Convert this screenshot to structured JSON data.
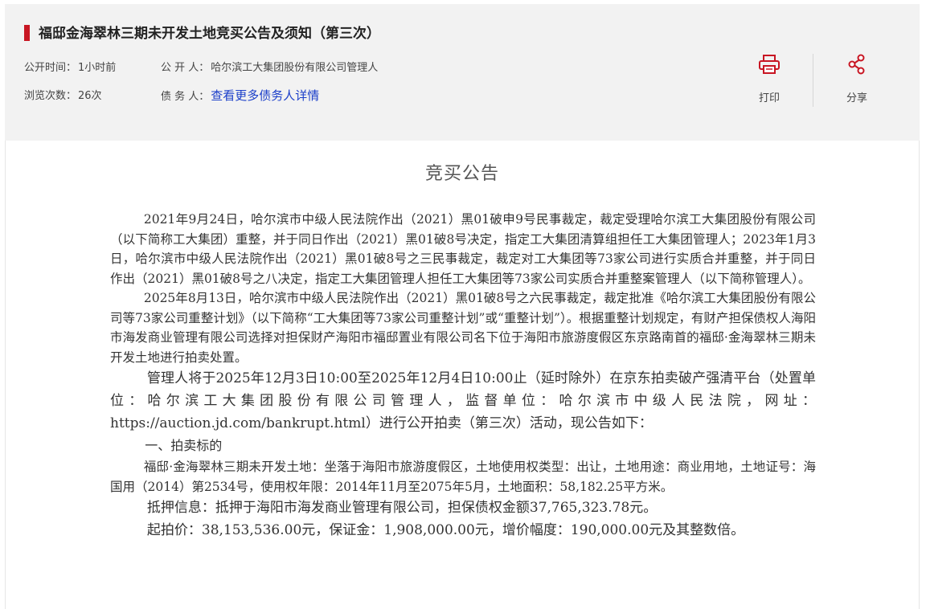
{
  "header": {
    "title": "福邸金海翠林三期未开发土地竞买公告及须知（第三次）",
    "publish_time_label": "公开时间：",
    "publish_time_value": "1小时前",
    "publisher_label": "公 开 人：",
    "publisher_value": "哈尔滨工大集团股份有限公司管理人",
    "views_label": "浏览次数：",
    "views_value": "26次",
    "debtor_label": "债 务 人：",
    "debtor_link": "查看更多债务人详情",
    "print_label": "打印",
    "share_label": "分享"
  },
  "icons": {
    "print": "printer-icon",
    "share": "share-icon"
  },
  "colors": {
    "accent": "#c81623",
    "link": "#1a3ec9"
  },
  "document": {
    "title": "竞买公告",
    "paragraphs": [
      "2021年9月24日，哈尔滨市中级人民法院作出（2021）黑01破申9号民事裁定，裁定受理哈尔滨工大集团股份有限公司（以下简称工大集团）重整，并于同日作出（2021）黑01破8号决定，指定工大集团清算组担任工大集团管理人；2023年1月3日，哈尔滨市中级人民法院作出（2021）黑01破8号之三民事裁定，裁定对工大集团等73家公司进行实质合并重整，并于同日作出（2021）黑01破8号之八决定，指定工大集团管理人担任工大集团等73家公司实质合并重整案管理人（以下简称管理人）。",
      "2025年8月13日，哈尔滨市中级人民法院作出（2021）黑01破8号之六民事裁定，裁定批准《哈尔滨工大集团股份有限公司等73家公司重整计划》（以下简称“工大集团等73家公司重整计划”或“重整计划”）。根据重整计划规定，有财产担保债权人海阳市海发商业管理有限公司选择对担保财产海阳市福邸置业有限公司名下位于海阳市旅游度假区东京路南首的福邸·金海翠林三期未开发土地进行拍卖处置。",
      "管理人将于2025年12月3日10:00至2025年12月4日10:00止（延时除外）在京东拍卖破产强清平台（处置单位：哈尔滨工大集团股份有限公司管理人，监督单位：哈尔滨市中级人民法院，网址：https://auction.jd.com/bankrupt.html）进行公开拍卖（第三次）活动，现公告如下：",
      "一、拍卖标的",
      "福邸·金海翠林三期未开发土地：坐落于海阳市旅游度假区，土地使用权类型：出让，土地用途：商业用地，土地证号：海国用（2014）第2534号，使用权年限：2014年11月至2075年5月，土地面积：58,182.25平方米。",
      "抵押信息：抵押于海阳市海发商业管理有限公司，担保债权金额37,765,323.78元。",
      "起拍价：38,153,536.00元，保证金：1,908,000.00元，增价幅度：190,000.00元及其整数倍。"
    ]
  }
}
